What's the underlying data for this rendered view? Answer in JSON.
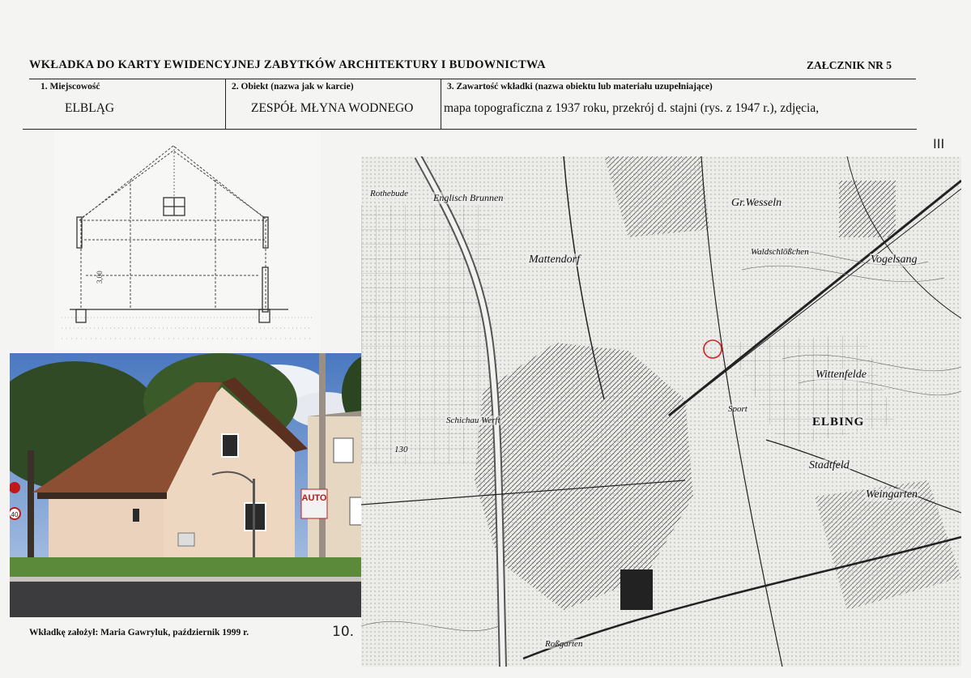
{
  "header": {
    "title": "WKŁADKA DO KARTY EWIDENCYJNEJ ZABYTKÓW ARCHITEKTURY I BUDOWNICTWA",
    "annex": "ZAŁCZNIK NR  5"
  },
  "fields": {
    "place_label": "1. Miejscowość",
    "place_value": "ELBLĄG",
    "object_label": "2. Obiekt (nazwa jak w karcie)",
    "object_value": "ZESPÓŁ MŁYNA WODNEGO",
    "contents_label": "3. Zawartość wkładki (nazwa obiektu lub materiału uzupełniające)",
    "contents_value": "mapa topograficzna z 1937 roku, przekrój d. stajni (rys. z 1947 r.), zdjęcia,"
  },
  "drawing": {
    "dimension": "3,00"
  },
  "photo": {
    "sign_text": "AUTO",
    "limit_sign": "40"
  },
  "map": {
    "labels": {
      "gr_wesseln": "Gr.Wesseln",
      "mattendorf": "Mattendorf",
      "vogelsang": "Vogelsang",
      "elbing": "ELBING",
      "stadtfeld": "Stadtfeld",
      "weingarten": "Weingarten",
      "wittenfelde": "Wittenfelde",
      "englisch_brunnen": "Englisch Brunnen",
      "rothebude": "Rothebude",
      "waldschlosschen": "Waldschlößchen",
      "schichau_werft": "Schichau Werft",
      "sport": "Sport",
      "rossgarten": "Roßgarten",
      "hohe": "130"
    }
  },
  "footer": {
    "author": "Wkładkę założył: Maria Gawryluk, październik 1999 r.",
    "page_number": "10.",
    "corner_mark": "III"
  },
  "colors": {
    "ink": "#111111",
    "paper": "#f4f4f2",
    "marker": "#d42020"
  }
}
